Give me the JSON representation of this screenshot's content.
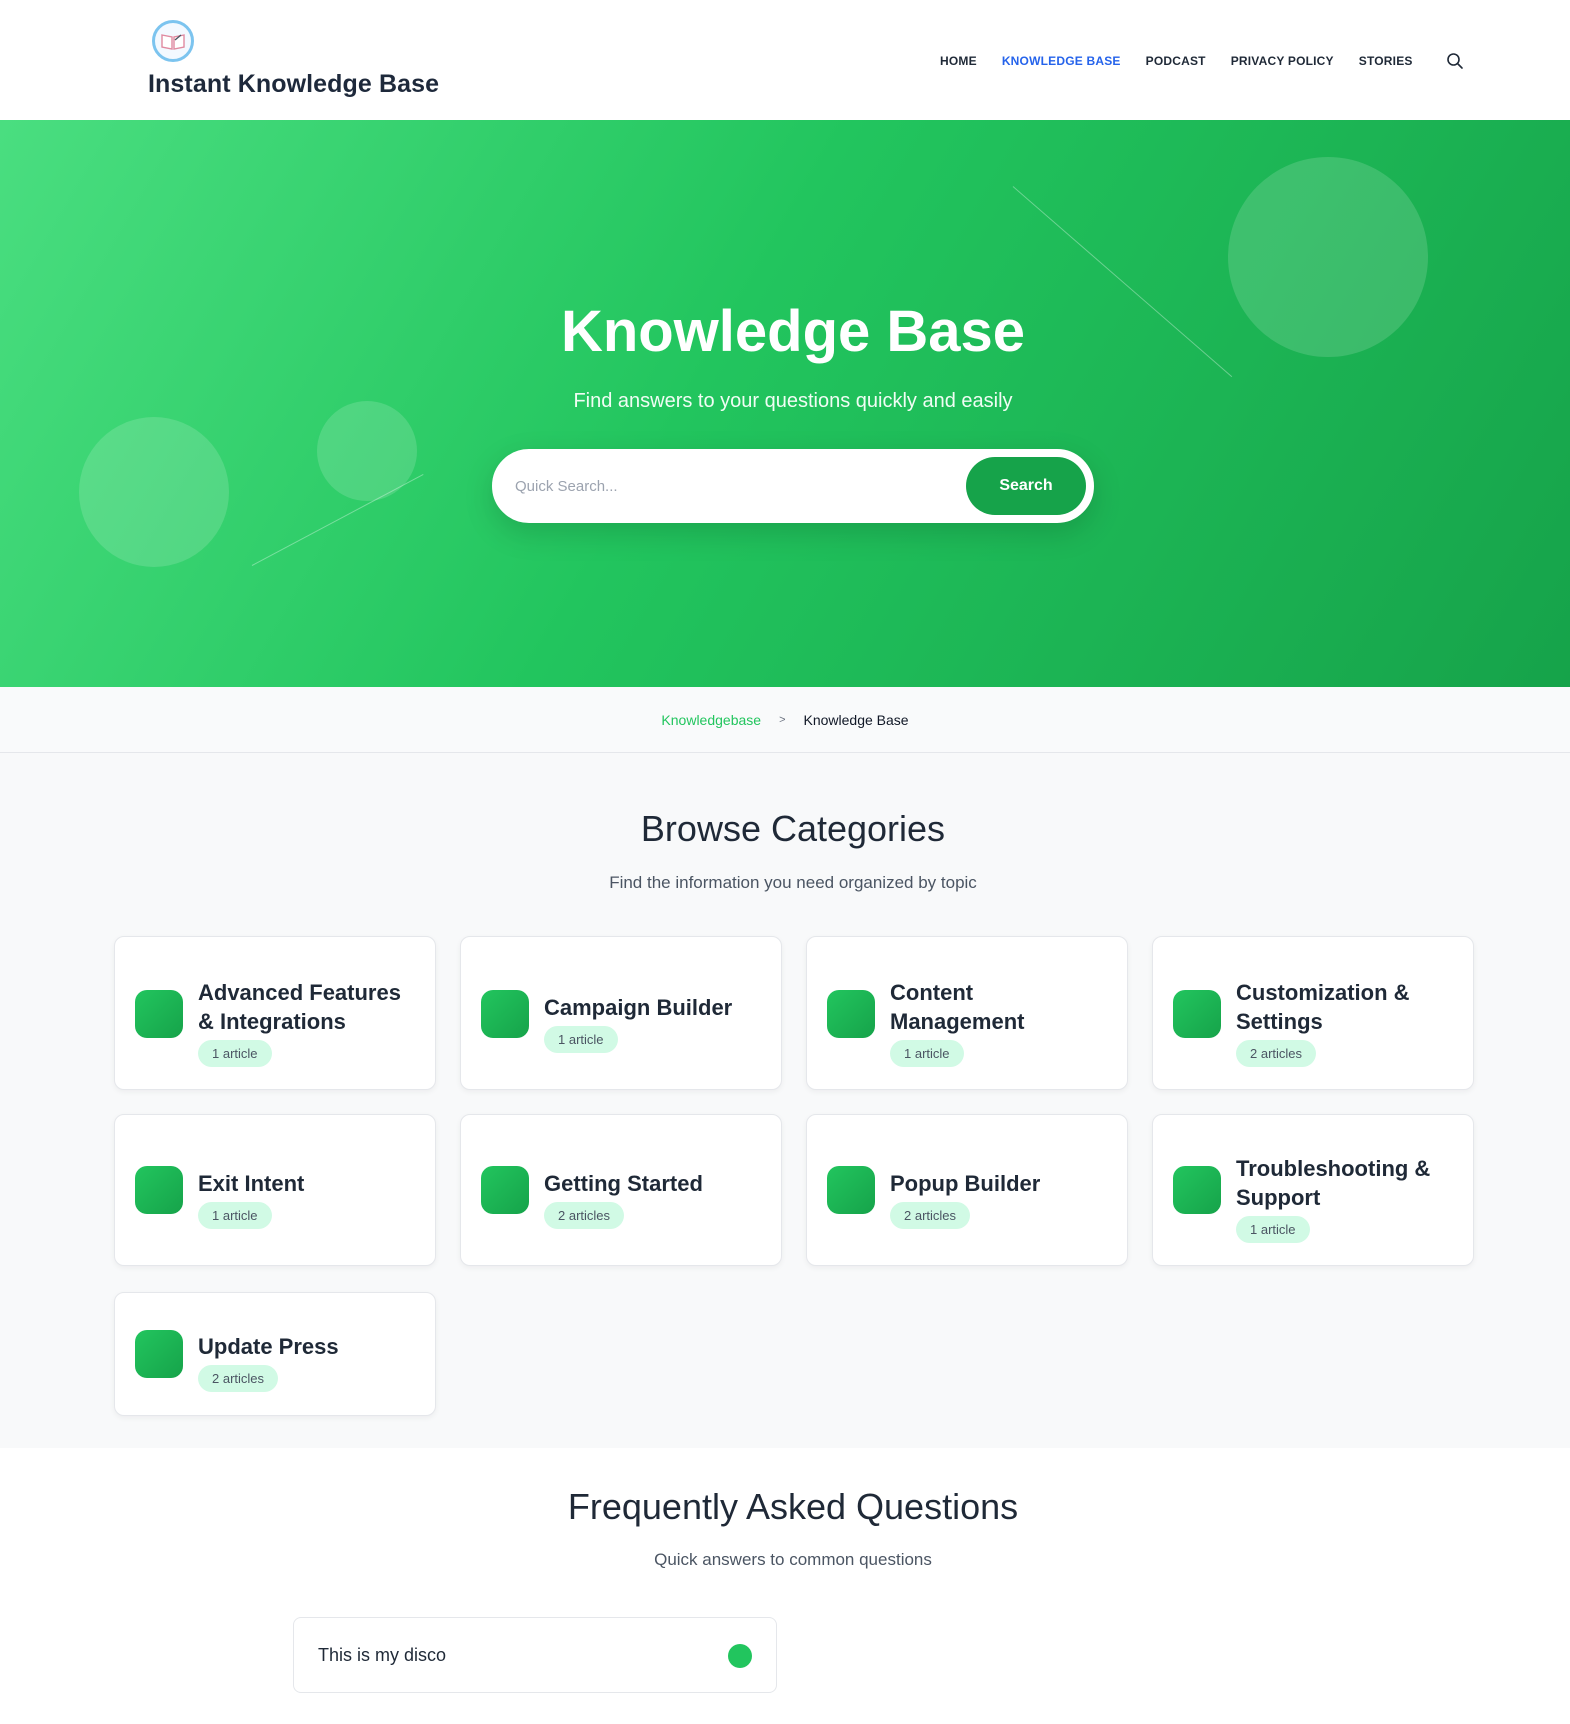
{
  "header": {
    "site_title": "Instant Knowledge Base",
    "logo_icon": "book-logo-icon",
    "nav": [
      "HOME",
      "KNOWLEDGE BASE",
      "PODCAST",
      "PRIVACY POLICY",
      "STORIES"
    ],
    "active_nav": "KNOWLEDGE BASE",
    "active_color": "#2563eb"
  },
  "hero": {
    "title": "Knowledge Base",
    "subtitle": "Find answers to your questions quickly and easily",
    "search_placeholder": "Quick Search...",
    "search_button": "Search",
    "gradient_start": "#4ade80",
    "gradient_end": "#16a34a"
  },
  "breadcrumb": {
    "items": [
      "Knowledgebase",
      "Knowledge Base"
    ],
    "separator": ">"
  },
  "categories": {
    "title": "Browse Categories",
    "subtitle": "Find the information you need organized by topic",
    "items": [
      {
        "name": "Advanced Features & Integrations",
        "count": "1 article"
      },
      {
        "name": "Campaign Builder",
        "count": "1 article"
      },
      {
        "name": "Content Management",
        "count": "1 article"
      },
      {
        "name": "Customization & Settings",
        "count": "2 articles"
      },
      {
        "name": "Exit Intent",
        "count": "1 article"
      },
      {
        "name": "Getting Started",
        "count": "2 articles"
      },
      {
        "name": "Popup Builder",
        "count": "2 articles"
      },
      {
        "name": "Troubleshooting & Support",
        "count": "1 article"
      },
      {
        "name": "Update Press",
        "count": "2 articles"
      }
    ]
  },
  "faq": {
    "title": "Frequently Asked Questions",
    "subtitle": "Quick answers to common questions",
    "items": [
      {
        "question": "This is my disco"
      }
    ]
  },
  "accent_color": "#22c55e"
}
